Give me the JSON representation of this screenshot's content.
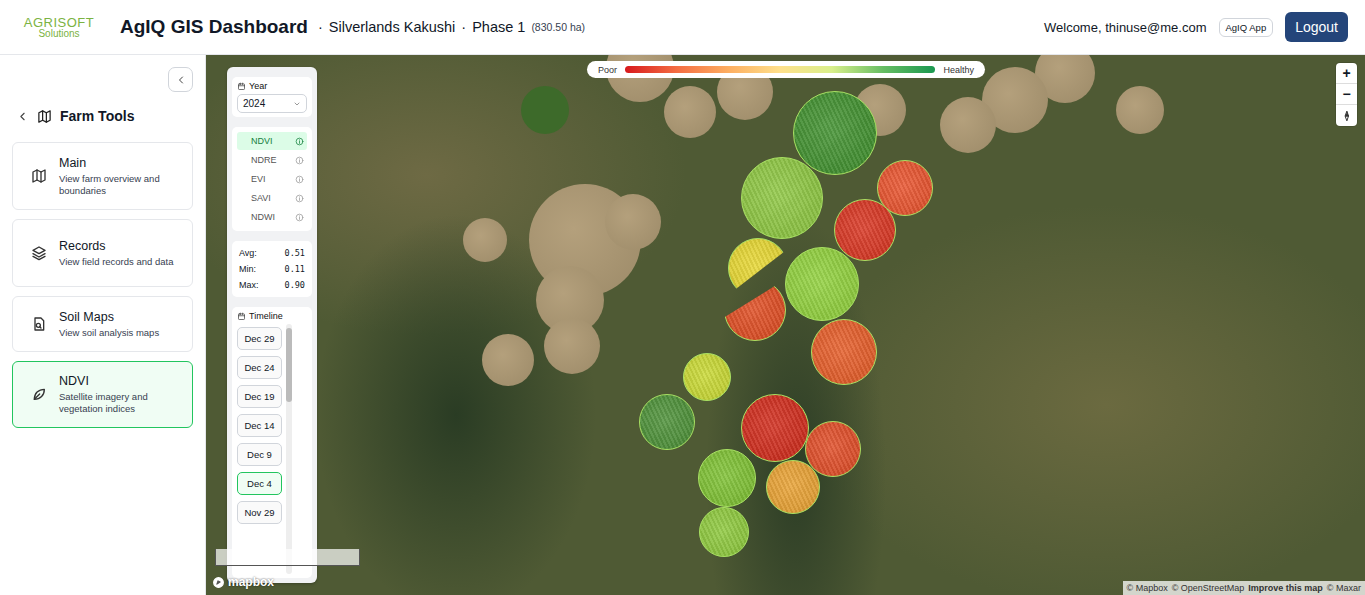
{
  "header": {
    "logo": {
      "brand": "AGRISOFT",
      "sub": "Solutions"
    },
    "title": "AgIQ GIS Dashboard",
    "separators": [
      "·",
      "·"
    ],
    "farm": "Silverlands Kakushi",
    "phase": "Phase 1",
    "area": "(830.50 ha)",
    "welcome": "Welcome, thinuse@me.com",
    "app_badge": "AgIQ App",
    "logout": "Logout"
  },
  "sidebar": {
    "title": "Farm Tools",
    "items": [
      {
        "title": "Main",
        "description": "View farm overview and boundaries",
        "selected": false
      },
      {
        "title": "Records",
        "description": "View field records and data",
        "selected": false
      },
      {
        "title": "Soil Maps",
        "description": "View soil analysis maps",
        "selected": false
      },
      {
        "title": "NDVI",
        "description": "Satellite imagery and vegetation indices",
        "selected": true
      }
    ]
  },
  "map": {
    "legend": {
      "poor": "Poor",
      "healthy": "Healthy"
    },
    "year": {
      "label": "Year",
      "value": "2024"
    },
    "indices": [
      {
        "label": "NDVI",
        "selected": true
      },
      {
        "label": "NDRE",
        "selected": false
      },
      {
        "label": "EVI",
        "selected": false
      },
      {
        "label": "SAVI",
        "selected": false
      },
      {
        "label": "NDWI",
        "selected": false
      }
    ],
    "stats": [
      {
        "label": "Avg:",
        "value": "0.51"
      },
      {
        "label": "Min:",
        "value": "0.11"
      },
      {
        "label": "Max:",
        "value": "0.90"
      }
    ],
    "timeline": {
      "label": "Timeline",
      "dates": [
        {
          "label": "Dec 29",
          "selected": false
        },
        {
          "label": "Dec 24",
          "selected": false
        },
        {
          "label": "Dec 19",
          "selected": false
        },
        {
          "label": "Dec 14",
          "selected": false
        },
        {
          "label": "Dec 9",
          "selected": false
        },
        {
          "label": "Dec 4",
          "selected": true
        },
        {
          "label": "Nov 29",
          "selected": false
        }
      ]
    },
    "fields": [
      {
        "color": "#3e8f2c",
        "kind": "full"
      },
      {
        "color": "#8cc63f",
        "kind": "full"
      },
      {
        "color": "#e8502a",
        "kind": "full"
      },
      {
        "color": "#d8321e",
        "kind": "full"
      },
      {
        "color": "#e6d62e",
        "kind": "upper"
      },
      {
        "color": "#df4a1f",
        "kind": "lower"
      },
      {
        "color": "#8fd03a",
        "kind": "full"
      },
      {
        "color": "#e55a25",
        "kind": "full"
      },
      {
        "color": "#c8d830",
        "kind": "full"
      },
      {
        "color": "#4a8f35",
        "kind": "full"
      },
      {
        "color": "#d02818",
        "kind": "full"
      },
      {
        "color": "#e04a24",
        "kind": "full"
      },
      {
        "color": "#7cc030",
        "kind": "full"
      },
      {
        "color": "#e8a030",
        "kind": "full"
      },
      {
        "color": "#8cc83a",
        "kind": "full"
      }
    ],
    "zoom": [
      "+",
      "−"
    ],
    "logo": "mapbox",
    "attribution": [
      {
        "text": "© Mapbox",
        "kind": "credit"
      },
      {
        "text": "© OpenStreetMap",
        "kind": "credit"
      },
      {
        "text": "Improve this map",
        "kind": "link"
      },
      {
        "text": "© Maxar",
        "kind": "credit"
      }
    ]
  }
}
